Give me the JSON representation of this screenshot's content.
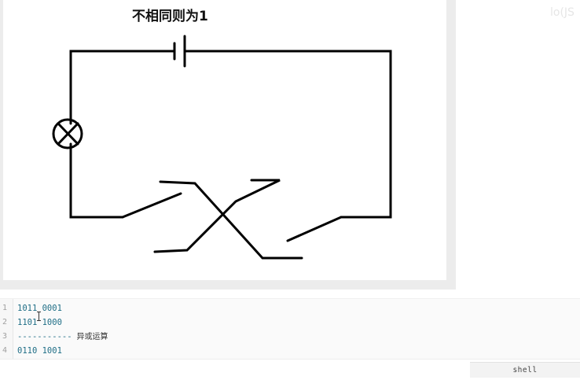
{
  "slide": {
    "title": "不相同则为1"
  },
  "watermark": "lo(JS",
  "editor": {
    "lines": [
      {
        "number": "1",
        "code": "1011 0001",
        "comment": ""
      },
      {
        "number": "2",
        "code": "1101 1000",
        "comment": ""
      },
      {
        "number": "3",
        "code": "-----------",
        "comment": "异或运算"
      },
      {
        "number": "4",
        "code": "0110 1001",
        "comment": ""
      }
    ]
  },
  "footer": {
    "language": "shell"
  }
}
